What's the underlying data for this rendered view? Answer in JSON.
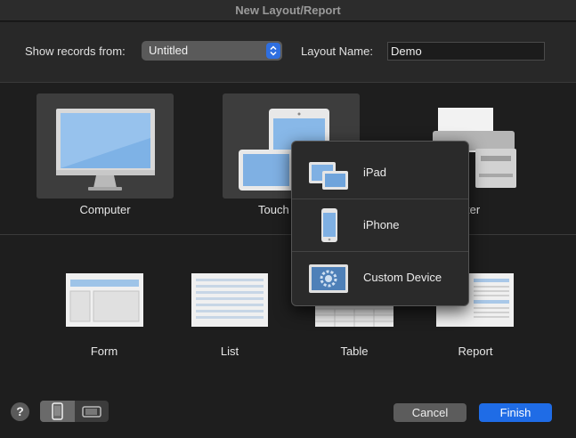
{
  "window": {
    "title": "New Layout/Report"
  },
  "header": {
    "show_records_label": "Show records from:",
    "show_records_value": "Untitled",
    "layout_name_label": "Layout Name:",
    "layout_name_value": "Demo"
  },
  "devices": [
    {
      "label": "Computer",
      "selected": true
    },
    {
      "label": "Touch",
      "selected": true
    },
    {
      "label": "ter",
      "selected": false
    }
  ],
  "device_menu": {
    "items": [
      {
        "label": "iPad",
        "icon": "ipad-icon"
      },
      {
        "label": "iPhone",
        "icon": "iphone-icon"
      },
      {
        "label": "Custom Device",
        "icon": "custom-device-icon"
      }
    ]
  },
  "layout_types": [
    {
      "label": "Form",
      "icon": "form-icon"
    },
    {
      "label": "List",
      "icon": "list-icon"
    },
    {
      "label": "Table",
      "icon": "table-icon"
    },
    {
      "label": "Report",
      "icon": "report-icon"
    }
  ],
  "footer": {
    "help_label": "?",
    "cancel_label": "Cancel",
    "finish_label": "Finish"
  },
  "colors": {
    "accent": "#1f6ce6",
    "background": "#1e1e1e",
    "selected_tile": "#3d3d3d"
  }
}
